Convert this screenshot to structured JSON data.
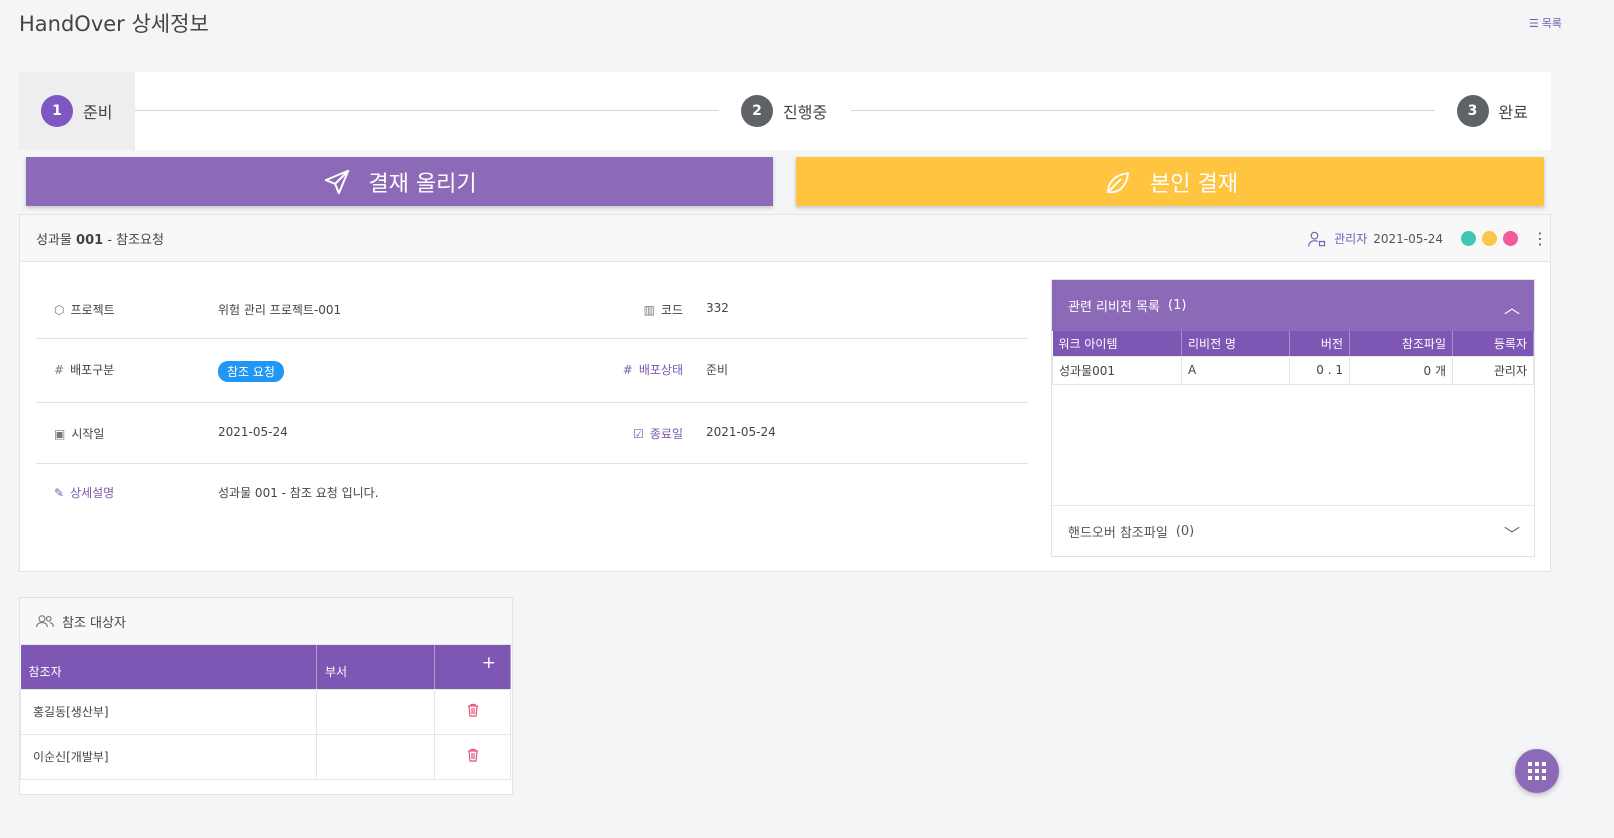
{
  "header": {
    "title": "HandOver 상세정보",
    "list_link": "목록"
  },
  "stepper": {
    "steps": [
      {
        "num": "1",
        "label": "준비"
      },
      {
        "num": "2",
        "label": "진행중"
      },
      {
        "num": "3",
        "label": "완료"
      }
    ]
  },
  "actions": {
    "submit_label": "결재 올리기",
    "self_label": "본인 결재"
  },
  "card": {
    "title_prefix": "성과물",
    "title_bold": "001",
    "title_suffix": "- 참조요청",
    "owner": "관리자",
    "date": "2021-05-24",
    "status_colors": [
      "#3ec8b4",
      "#f9c64a",
      "#f05b9a"
    ]
  },
  "info": {
    "project_label": "프로젝트",
    "project_value": "위험 관리 프로젝트-001",
    "code_label": "코드",
    "code_value": "332",
    "dist_type_label": "배포구분",
    "dist_type_value": "참조 요청",
    "dist_status_label": "배포상태",
    "dist_status_value": "준비",
    "start_label": "시작일",
    "start_value": "2021-05-24",
    "end_label": "종료일",
    "end_value": "2021-05-24",
    "desc_label": "상세설명",
    "desc_value": "성과물 001 - 참조 요청 입니다."
  },
  "revisions": {
    "title": "관련 리비전 목록",
    "count": "(1)",
    "columns": [
      "워크 아이템",
      "리비전 명",
      "버전",
      "참조파일",
      "등록자"
    ],
    "rows": [
      {
        "item": "성과물001",
        "rev": "A",
        "version": "0 . 1",
        "files": "0 개",
        "author": "관리자"
      }
    ],
    "files_title": "핸드오버 참조파일",
    "files_count": "(0)"
  },
  "references": {
    "title": "참조 대상자",
    "columns": [
      "참조자",
      "부서"
    ],
    "add": "+",
    "rows": [
      {
        "name": "홍길동[생산부]",
        "dept": ""
      },
      {
        "name": "이순신[개발부]",
        "dept": ""
      }
    ]
  }
}
